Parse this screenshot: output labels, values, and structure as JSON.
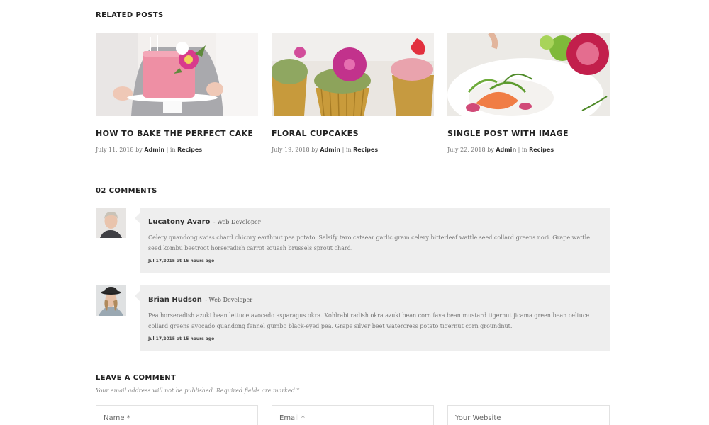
{
  "related": {
    "title": "RELATED POSTS",
    "posts": [
      {
        "title": "HOW TO BAKE THE PERFECT CAKE",
        "date": "July 11, 2018",
        "by": "by",
        "author": "Admin",
        "sep": "| in",
        "category": "Recipes"
      },
      {
        "title": "FLORAL CUPCAKES",
        "date": "July 19, 2018",
        "by": "by",
        "author": "Admin",
        "sep": "| in",
        "category": "Recipes"
      },
      {
        "title": "SINGLE POST WITH IMAGE",
        "date": "July 22, 2018",
        "by": "by",
        "author": "Admin",
        "sep": "| in",
        "category": "Recipes"
      }
    ]
  },
  "comments": {
    "title": "02 COMMENTS",
    "items": [
      {
        "name": "Lucatony Avaro",
        "role": "- Web Developer",
        "text": "Celery quandong swiss chard chicory earthnut pea potato. Salsify taro catsear garlic gram celery bitterleaf wattle seed collard greens nori. Grape wattle seed kombu beetroot horseradish carrot squash brussels sprout chard.",
        "date": "Jul 17,2015 at 15 hours ago"
      },
      {
        "name": "Brian Hudson",
        "role": "- Web Developer",
        "text": "Pea horseradish azuki bean lettuce avocado asparagus okra. Kohlrabi radish okra azuki bean corn fava bean mustard tigernut jicama green bean celtuce collard greens avocado quandong fennel gumbo black-eyed pea. Grape silver beet watercress potato tigernut corn groundnut.",
        "date": "Jul 17,2015 at 15 hours ago"
      }
    ]
  },
  "leave": {
    "title": "LEAVE A COMMENT",
    "note": "Your email address will not be published. Required fields are marked *",
    "fields": {
      "name_placeholder": "Name *",
      "email_placeholder": "Email *",
      "website_placeholder": "Your Website"
    }
  },
  "colors": {
    "bubble": "#eeeeee",
    "divider": "#e6e6e6",
    "text": "#222222"
  }
}
